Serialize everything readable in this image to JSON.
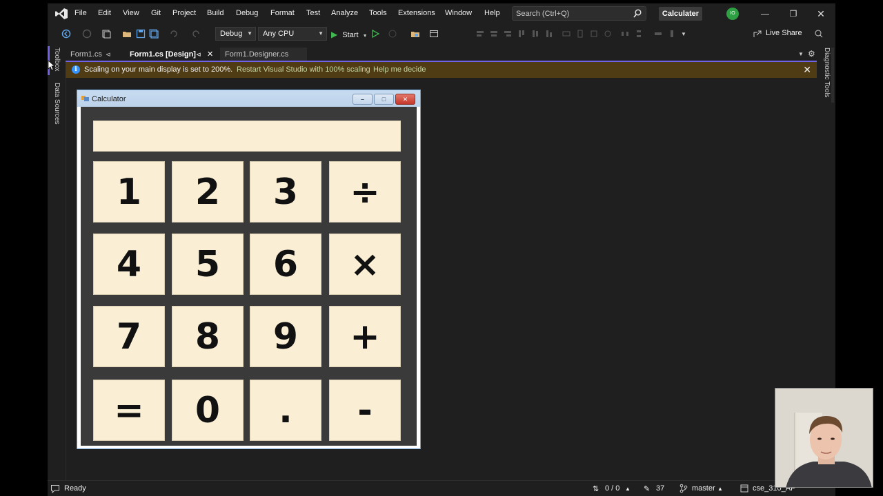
{
  "menu": {
    "items": [
      "File",
      "Edit",
      "View",
      "Git",
      "Project",
      "Build",
      "Debug",
      "Format",
      "Test",
      "Analyze",
      "Tools",
      "Extensions",
      "Window",
      "Help"
    ],
    "search_placeholder": "Search (Ctrl+Q)",
    "solution_name": "Calculater",
    "account_initials": "IO"
  },
  "toolbar": {
    "configuration": "Debug",
    "platform": "Any CPU",
    "start_label": "Start",
    "live_share": "Live Share"
  },
  "side_tabs": {
    "left": [
      "Toolbox",
      "Data Sources"
    ],
    "right": [
      "Diagnostic Tools"
    ]
  },
  "doc_tabs": [
    {
      "label": "Form1.cs",
      "active": false,
      "pinned": true
    },
    {
      "label": "Form1.cs [Design]",
      "active": true,
      "pinned": true
    },
    {
      "label": "Form1.Designer.cs",
      "active": false,
      "pinned": false
    }
  ],
  "infobar": {
    "message": "Scaling on your main display is set to 200%.",
    "link_restart": "Restart Visual Studio with 100% scaling",
    "link_help": "Help me decide"
  },
  "form": {
    "title": "Calculator",
    "display_value": "",
    "keys": [
      "1",
      "2",
      "3",
      "÷",
      "4",
      "5",
      "6",
      "×",
      "7",
      "8",
      "9",
      "+",
      "=",
      "0",
      ".",
      "-"
    ]
  },
  "status": {
    "state": "Ready",
    "changes": "0 / 0",
    "edits": "37",
    "branch": "master",
    "repo": "cse_310_AP"
  },
  "colors": {
    "ide_bg": "#1f1f1f",
    "accent": "#7160e8",
    "infobar_bg": "#4f3c14",
    "key_bg": "#faefd5",
    "form_client_bg": "#3a3a3a"
  }
}
